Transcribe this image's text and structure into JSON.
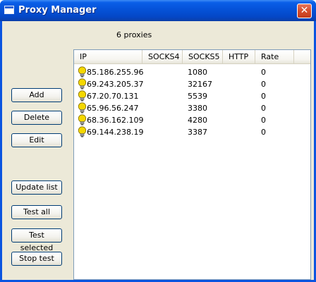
{
  "window": {
    "title": "Proxy Manager",
    "close_label": "✕"
  },
  "status": {
    "count_text": "6 proxies"
  },
  "buttons": {
    "add": "Add",
    "delete": "Delete",
    "edit": "Edit",
    "update_list": "Update list",
    "test_all": "Test all",
    "test_selected": "Test selected",
    "stop_test": "Stop test"
  },
  "table": {
    "columns": [
      "IP",
      "SOCKS4",
      "SOCKS5",
      "HTTP",
      "Rate"
    ],
    "rows": [
      {
        "ip": "85.186.255.96",
        "socks4": "",
        "socks5": "1080",
        "http": "",
        "rate": "0"
      },
      {
        "ip": "69.243.205.37",
        "socks4": "",
        "socks5": "32167",
        "http": "",
        "rate": "0"
      },
      {
        "ip": "67.20.70.131",
        "socks4": "",
        "socks5": "5539",
        "http": "",
        "rate": "0"
      },
      {
        "ip": "65.96.56.247",
        "socks4": "",
        "socks5": "3380",
        "http": "",
        "rate": "0"
      },
      {
        "ip": "68.36.162.109",
        "socks4": "",
        "socks5": "4280",
        "http": "",
        "rate": "0"
      },
      {
        "ip": "69.144.238.19",
        "socks4": "",
        "socks5": "3387",
        "http": "",
        "rate": "0"
      }
    ],
    "row_icon": "lightbulb-icon"
  },
  "colors": {
    "titlebar": "#0552d8",
    "client_bg": "#ece9d8",
    "close_button": "#d64e2d",
    "bulb": "#f5d800"
  }
}
